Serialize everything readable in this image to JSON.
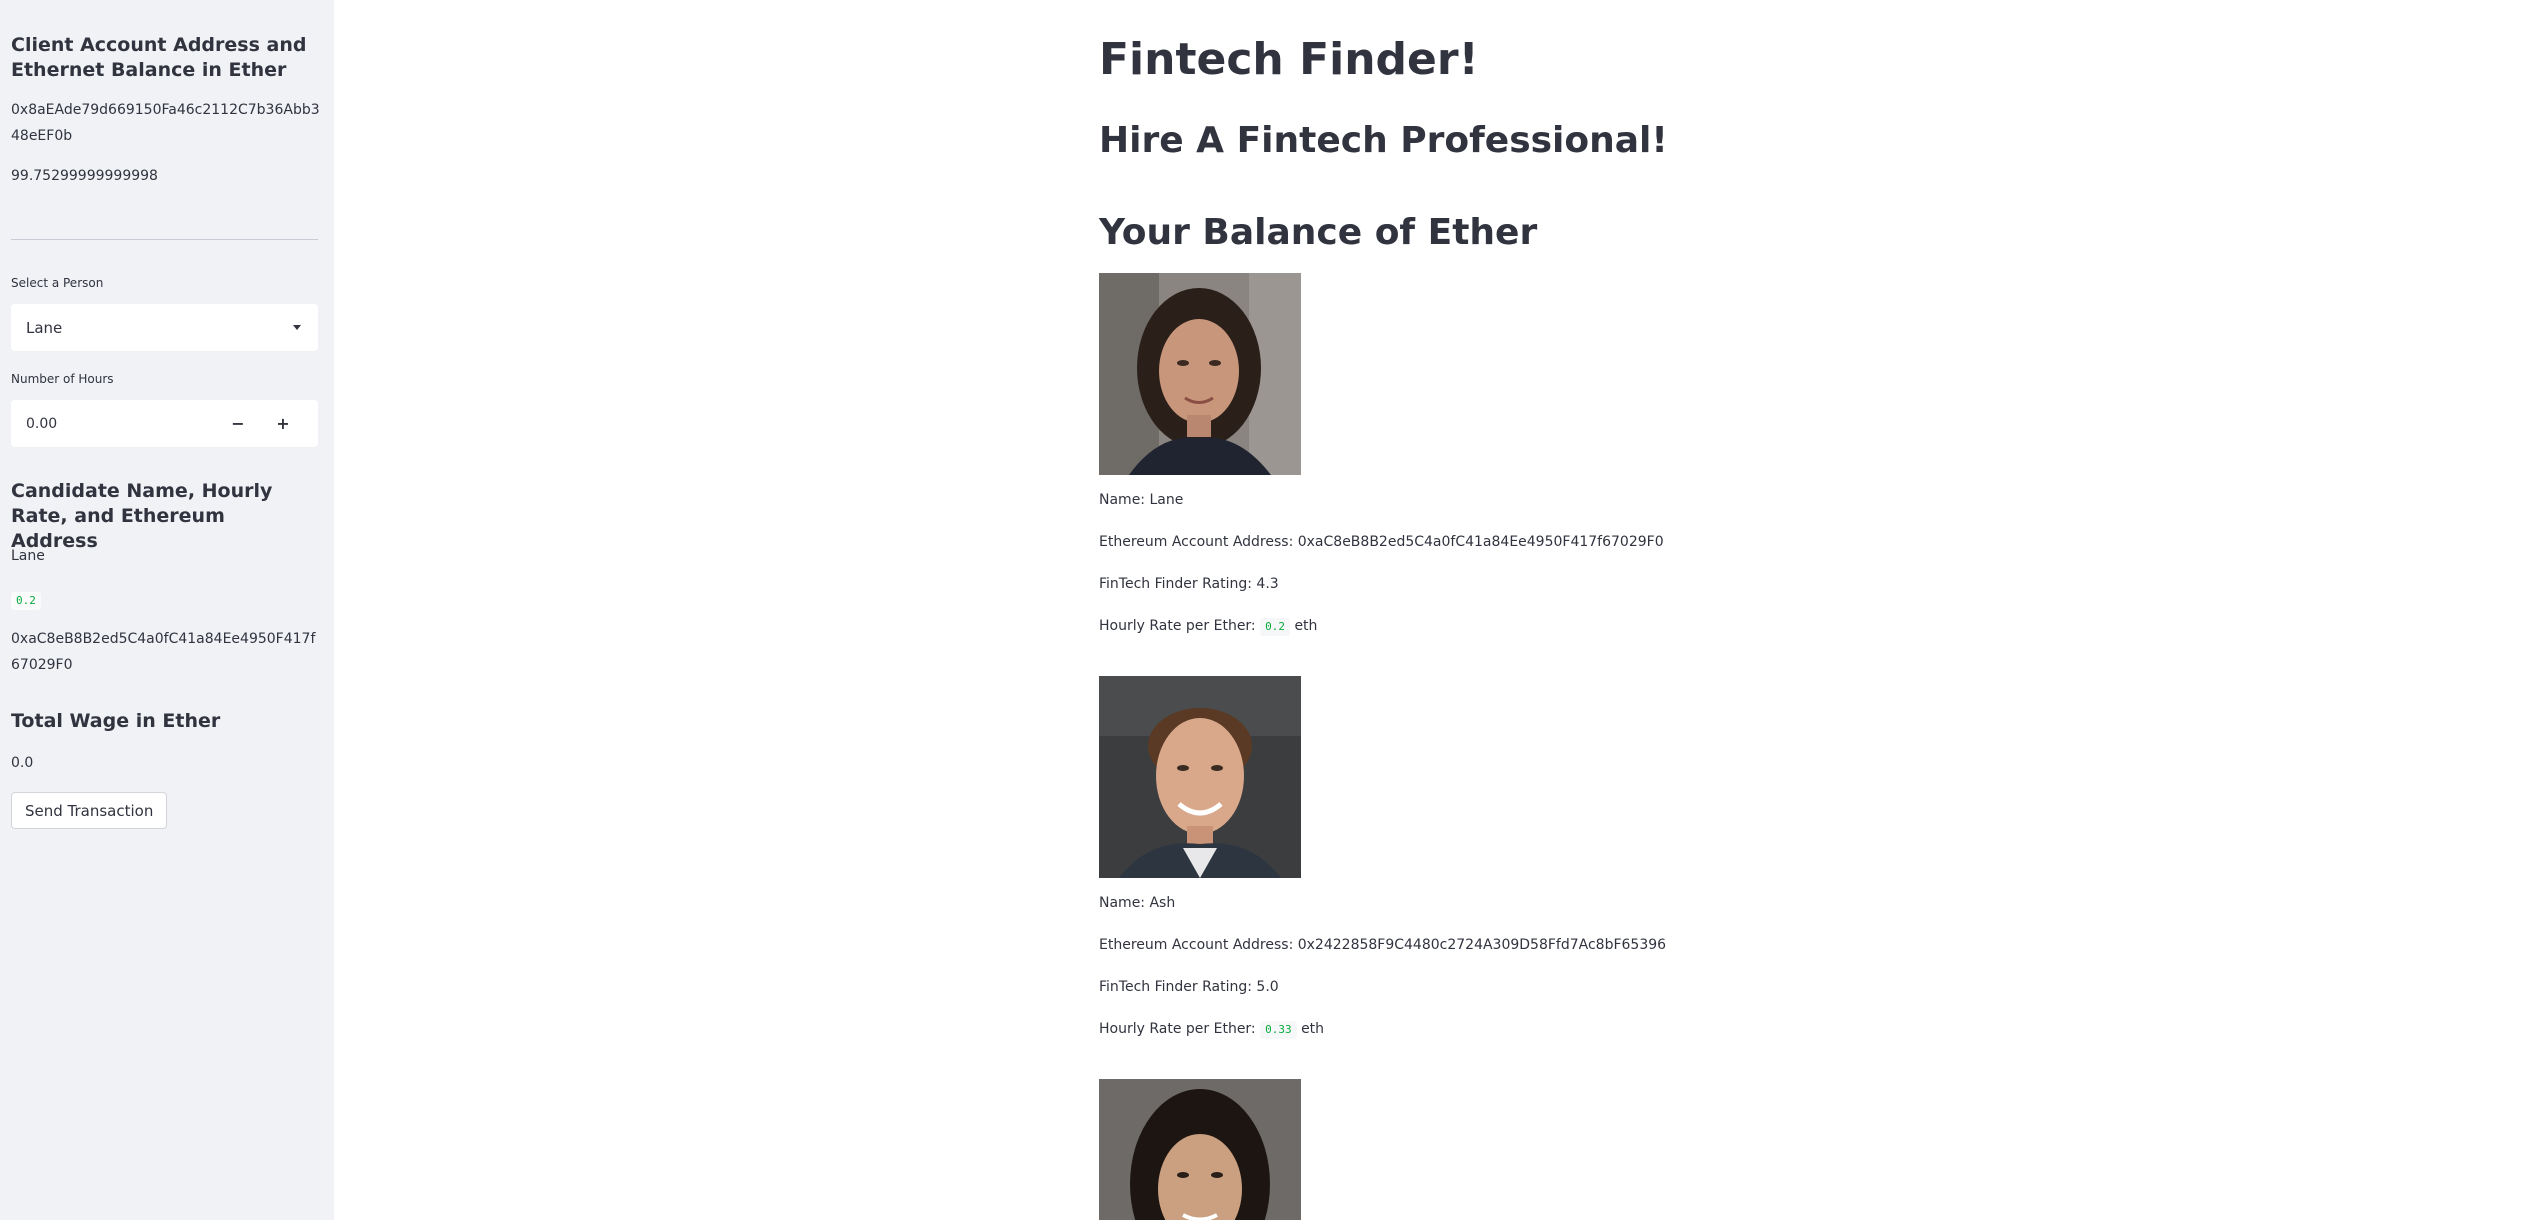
{
  "sidebar": {
    "account_heading": "Client Account Address and Ethernet Balance in Ether",
    "account_address": "0x8aEAde79d669150Fa46c2112C7b36Abb348eEF0b",
    "account_balance": "99.75299999999998",
    "select_label": "Select a Person",
    "selected_person": "Lane",
    "hours_label": "Number of Hours",
    "hours_value": "0.00",
    "decrement_label": "−",
    "increment_label": "+",
    "candidate_heading": "Candidate Name, Hourly Rate, and Ethereum Address",
    "candidate_name": "Lane",
    "candidate_rate": "0.2",
    "candidate_address": "0xaC8eB8B2ed5C4a0fC41a84Ee4950F417f67029F0",
    "wage_heading": "Total Wage in Ether",
    "wage_value": "0.0",
    "send_button_label": "Send Transaction"
  },
  "main": {
    "title": "Fintech Finder!",
    "subtitle": "Hire A Fintech Professional!",
    "balance_heading": "Your Balance of Ether",
    "candidates": [
      {
        "name": "Name: Lane",
        "address": "Ethereum Account Address: 0xaC8eB8B2ed5C4a0fC41a84Ee4950F417f67029F0",
        "rating": "FinTech Finder Rating: 4.3",
        "rate_label": "Hourly Rate per Ether:",
        "rate_value": "0.2",
        "rate_unit": "eth"
      },
      {
        "name": "Name: Ash",
        "address": "Ethereum Account Address: 0x2422858F9C4480c2724A309D58Ffd7Ac8bF65396",
        "rating": "FinTech Finder Rating: 5.0",
        "rate_label": "Hourly Rate per Ether:",
        "rate_value": "0.33",
        "rate_unit": "eth"
      }
    ]
  }
}
